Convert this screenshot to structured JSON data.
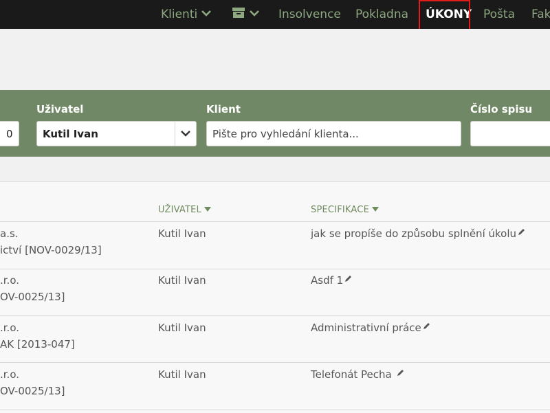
{
  "nav": {
    "items": [
      "Klienti",
      "Insolvence",
      "Pokladna",
      "ÚKONY",
      "Pošta",
      "Fak"
    ],
    "active": "ÚKONY"
  },
  "filters": {
    "left_value": "0",
    "user_label": "Uživatel",
    "user_value": "Kutil Ivan",
    "client_label": "Klient",
    "client_placeholder": "Pište pro vyhledání klienta...",
    "file_label": "Číslo spisu",
    "file_value": ""
  },
  "table": {
    "headers": {
      "user": "UŽIVATEL",
      "spec": "SPECIFIKACE"
    },
    "rows": [
      {
        "client_line1": "a.s.",
        "client_line2": "ictví [NOV-0029/13]",
        "user": "Kutil Ivan",
        "spec": "jak se propíše do způsobu splnění úkolu"
      },
      {
        "client_line1": ".r.o.",
        "client_line2": "OV-0025/13]",
        "user": "Kutil Ivan",
        "spec": "Asdf 1"
      },
      {
        "client_line1": ".r.o.",
        "client_line2": "AK [2013-047]",
        "user": "Kutil Ivan",
        "spec": "Administrativní práce"
      },
      {
        "client_line1": ".r.o.",
        "client_line2": "OV-0025/13]",
        "user": "Kutil Ivan",
        "spec": "Telefonát Pecha"
      }
    ]
  },
  "colors": {
    "topbar": "#1a1a1a",
    "nav_text": "#8ea882",
    "active_outline": "#e21b1b",
    "filterbar": "#718866",
    "header_text": "#6f8a5e"
  }
}
